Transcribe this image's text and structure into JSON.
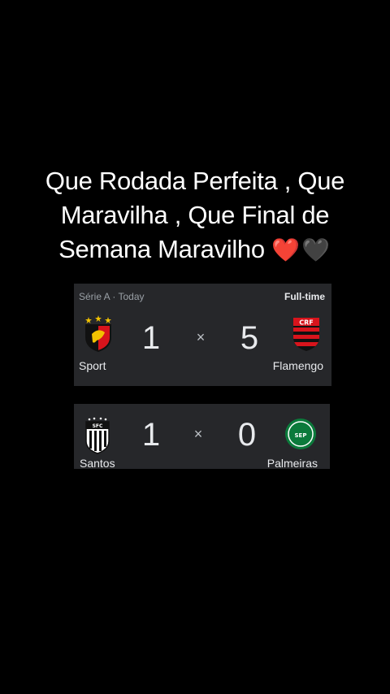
{
  "caption": {
    "line1": "Que Rodada Perfeita , Que",
    "line2": "Maravilha , Que Final de",
    "line3": "Semana Maravilho",
    "hearts": "❤️🖤"
  },
  "match1": {
    "competition": "Série A · Today",
    "status": "Full-time",
    "home": {
      "name": "Sport",
      "score": "1",
      "crest_icon": "sport-recife-crest-icon"
    },
    "separator": "×",
    "away": {
      "name": "Flamengo",
      "score": "5",
      "crest_icon": "flamengo-crest-icon"
    }
  },
  "match2": {
    "home": {
      "name": "Santos",
      "score": "1",
      "crest_icon": "santos-crest-icon"
    },
    "separator": "×",
    "away": {
      "name": "Palmeiras",
      "score": "0",
      "crest_icon": "palmeiras-crest-icon"
    }
  },
  "colors": {
    "background": "#000000",
    "card": "#26272a",
    "text": "#e8eaed",
    "muted": "#9aa0a6"
  }
}
